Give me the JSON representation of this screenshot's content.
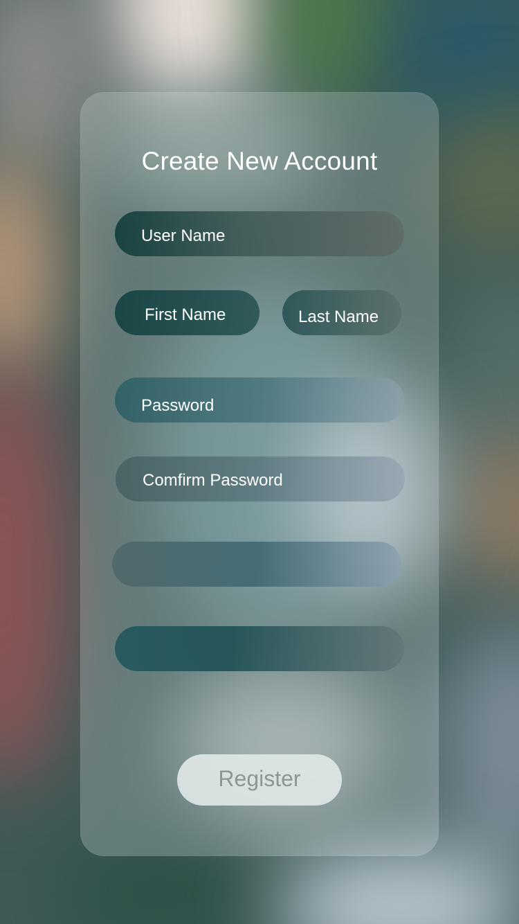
{
  "form": {
    "title": "Create New Account",
    "username_placeholder": "User Name",
    "firstname_placeholder": "First Name",
    "lastname_placeholder": "Last Name",
    "password_placeholder": "Password",
    "confirm_password_placeholder": "Comfirm Password",
    "register_label": "Register"
  },
  "colors": {
    "text": "#ffffff",
    "button_text": "#8b9696",
    "button_bg": "#e1e8e8"
  }
}
